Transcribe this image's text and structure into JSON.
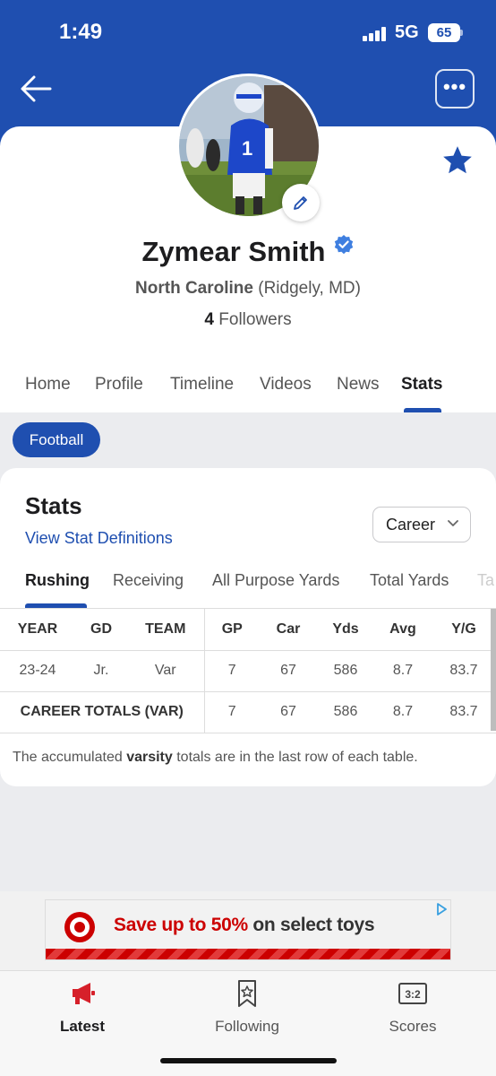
{
  "status_bar": {
    "time": "1:49",
    "network": "5G",
    "battery": "65"
  },
  "header": {
    "back_icon": "arrow-left-icon",
    "more_icon": "ellipsis-icon",
    "more_label": "•••",
    "favorite_icon": "star-icon",
    "edit_icon": "pencil-icon"
  },
  "profile": {
    "name": "Zymear Smith",
    "school": "North Caroline",
    "location": "(Ridgely, MD)",
    "followers_count": "4",
    "followers_label": "Followers"
  },
  "nav_tabs": [
    {
      "label": "Home"
    },
    {
      "label": "Profile"
    },
    {
      "label": "Timeline"
    },
    {
      "label": "Videos"
    },
    {
      "label": "News"
    },
    {
      "label": "Stats",
      "active": true
    }
  ],
  "sport": "Football",
  "stats": {
    "title": "Stats",
    "definitions_link": "View Stat Definitions",
    "period_select": "Career",
    "sub_tabs": [
      {
        "label": "Rushing",
        "active": true
      },
      {
        "label": "Receiving"
      },
      {
        "label": "All Purpose Yards"
      },
      {
        "label": "Total Yards"
      },
      {
        "label": "Ta"
      }
    ],
    "columns": [
      "YEAR",
      "GD",
      "TEAM",
      "GP",
      "Car",
      "Yds",
      "Avg",
      "Y/G"
    ],
    "rows": [
      [
        "23-24",
        "Jr.",
        "Var",
        "7",
        "67",
        "586",
        "8.7",
        "83.7"
      ]
    ],
    "totals": {
      "label": "CAREER TOTALS (VAR)",
      "values": [
        "7",
        "67",
        "586",
        "8.7",
        "83.7"
      ]
    },
    "note_prefix": "The accumulated",
    "note_bold": "varsity",
    "note_suffix": "totals are in the last row of each table."
  },
  "ad": {
    "text_highlight": "Save up to 50%",
    "text_rest": "on select toys",
    "brand_color": "#cc0000"
  },
  "bottom_nav": [
    {
      "label": "Latest",
      "icon": "megaphone-icon",
      "active": true
    },
    {
      "label": "Following",
      "icon": "bookmark-star-icon"
    },
    {
      "label": "Scores",
      "icon": "scoreboard-icon",
      "icon_text": "3:2"
    }
  ],
  "colors": {
    "accent": "#1f4fb0",
    "active_red": "#d6202a"
  }
}
